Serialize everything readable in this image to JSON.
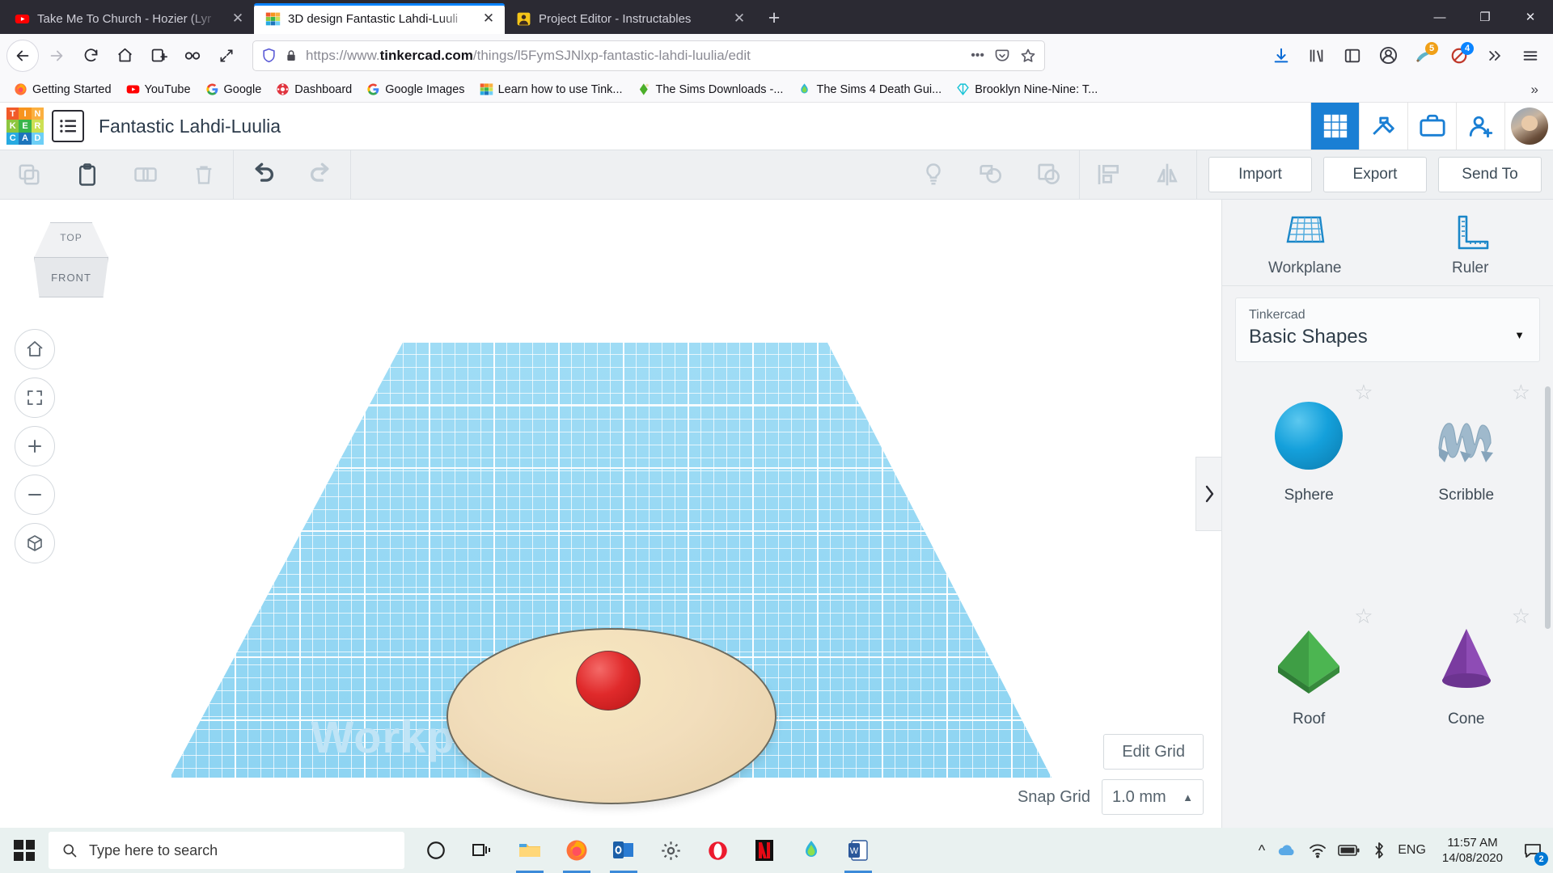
{
  "browser": {
    "tabs": [
      {
        "title": "Take Me To Church - Hozier (Lyr",
        "favicon": "youtube-icon",
        "active": false
      },
      {
        "title": "3D design Fantastic Lahdi-Luuli",
        "favicon": "tinkercad-icon",
        "active": true
      },
      {
        "title": "Project Editor - Instructables",
        "favicon": "instructables-icon",
        "active": false
      }
    ],
    "new_tab_label": "+",
    "window_controls": {
      "minimize": "—",
      "maximize": "❐",
      "close": "✕"
    },
    "nav": {
      "back": "←",
      "forward": "→",
      "reload": "⟳",
      "home": "⌂",
      "library_add": "⊡",
      "container": "∞",
      "fullscreen": "⤢"
    },
    "url": {
      "scheme": "https://www.",
      "domain": "tinkercad.com",
      "path": "/things/l5FymSJNlxp-fantastic-lahdi-luulia/edit",
      "full": "https://www.tinkercad.com/things/l5FymSJNlxp-fantastic-lahdi-luulia/edit"
    },
    "toolbar_badges": {
      "pocket_count": "5",
      "shield_count": "4"
    },
    "bookmarks": [
      {
        "label": "Getting Started",
        "icon": "firefox-icon"
      },
      {
        "label": "YouTube",
        "icon": "youtube-icon"
      },
      {
        "label": "Google",
        "icon": "google-icon"
      },
      {
        "label": "Dashboard",
        "icon": "canvas-icon"
      },
      {
        "label": "Google Images",
        "icon": "google-icon"
      },
      {
        "label": "Learn how to use Tink...",
        "icon": "tinkercad-icon"
      },
      {
        "label": "The Sims Downloads -...",
        "icon": "sims-icon"
      },
      {
        "label": "The Sims 4 Death Gui...",
        "icon": "sims4-icon"
      },
      {
        "label": "Brooklyn Nine-Nine: T...",
        "icon": "teal-diamond-icon"
      }
    ],
    "bookmarks_overflow": "»"
  },
  "tinkercad": {
    "logo_letters": [
      "T",
      "I",
      "N",
      "K",
      "E",
      "R",
      "C",
      "A",
      "D"
    ],
    "project_title": "Fantastic Lahdi-Luulia",
    "header_icons": [
      "grid-view-icon",
      "codeblocks-icon",
      "teach-icon",
      "add-person-icon",
      "user-avatar"
    ],
    "toolbar": {
      "left_icons": [
        "copy-icon",
        "paste-icon",
        "duplicate-icon",
        "delete-icon"
      ],
      "history_icons": [
        "undo-icon",
        "redo-icon"
      ],
      "view_icons": [
        "light-bulb-icon",
        "group-icon",
        "ungroup-icon",
        "align-icon",
        "mirror-icon"
      ],
      "buttons": [
        "Import",
        "Export",
        "Send To"
      ]
    },
    "viewcube": {
      "top": "TOP",
      "front": "FRONT"
    },
    "nav_controls": [
      "home-view-icon",
      "fit-view-icon",
      "zoom-in-icon",
      "zoom-out-icon",
      "perspective-icon"
    ],
    "workplane_label": "Workplane",
    "grid": {
      "edit_grid_label": "Edit Grid",
      "snap_grid_label": "Snap Grid",
      "snap_grid_value": "1.0 mm",
      "snap_caret": "▲"
    },
    "panel": {
      "handle_icon": "chevron-right-icon",
      "tools": [
        {
          "label": "Workplane",
          "icon": "workplane-icon"
        },
        {
          "label": "Ruler",
          "icon": "ruler-icon"
        }
      ],
      "library_source": "Tinkercad",
      "library_name": "Basic Shapes",
      "caret": "▼",
      "shapes": [
        {
          "name": "Sphere",
          "icon": "sphere-shape",
          "color": "#12a0db",
          "favorited": false
        },
        {
          "name": "Scribble",
          "icon": "scribble-shape",
          "color": "#9fb9cc",
          "favorited": false
        },
        {
          "name": "Roof",
          "icon": "roof-shape",
          "color": "#3c9b42",
          "favorited": false
        },
        {
          "name": "Cone",
          "icon": "cone-shape",
          "color": "#8a4bb0",
          "favorited": false
        }
      ],
      "star_glyph": "☆"
    },
    "scene": {
      "disc_color": "#f0ddb8",
      "ball_color": "#d92c2d",
      "workplane_color": "#8fd5f2"
    }
  },
  "taskbar": {
    "start_icon": "windows-start-icon",
    "search_placeholder": "Type here to search",
    "search_icon": "search-icon",
    "apps": [
      {
        "name": "cortana-icon"
      },
      {
        "name": "task-view-icon"
      },
      {
        "name": "file-explorer-icon",
        "open": true
      },
      {
        "name": "firefox-icon",
        "open": true
      },
      {
        "name": "outlook-icon",
        "open": true
      },
      {
        "name": "settings-icon"
      },
      {
        "name": "opera-icon"
      },
      {
        "name": "netflix-icon"
      },
      {
        "name": "sims4-icon"
      },
      {
        "name": "word-icon",
        "open": true
      }
    ],
    "tray": {
      "expand_icon": "^",
      "icons": [
        "onedrive-icon",
        "wifi-icon",
        "battery-icon",
        "bluetooth-icon"
      ],
      "language": "ENG",
      "time": "11:57 AM",
      "date": "14/08/2020",
      "notification_icon": "action-center-icon",
      "notification_count": "2"
    }
  },
  "colors": {
    "firefox_chrome": "#2b2a33",
    "accent_blue": "#0a84ff",
    "tinkercad_blue": "#1a7fd4",
    "taskbar": "#e9f1f0"
  }
}
